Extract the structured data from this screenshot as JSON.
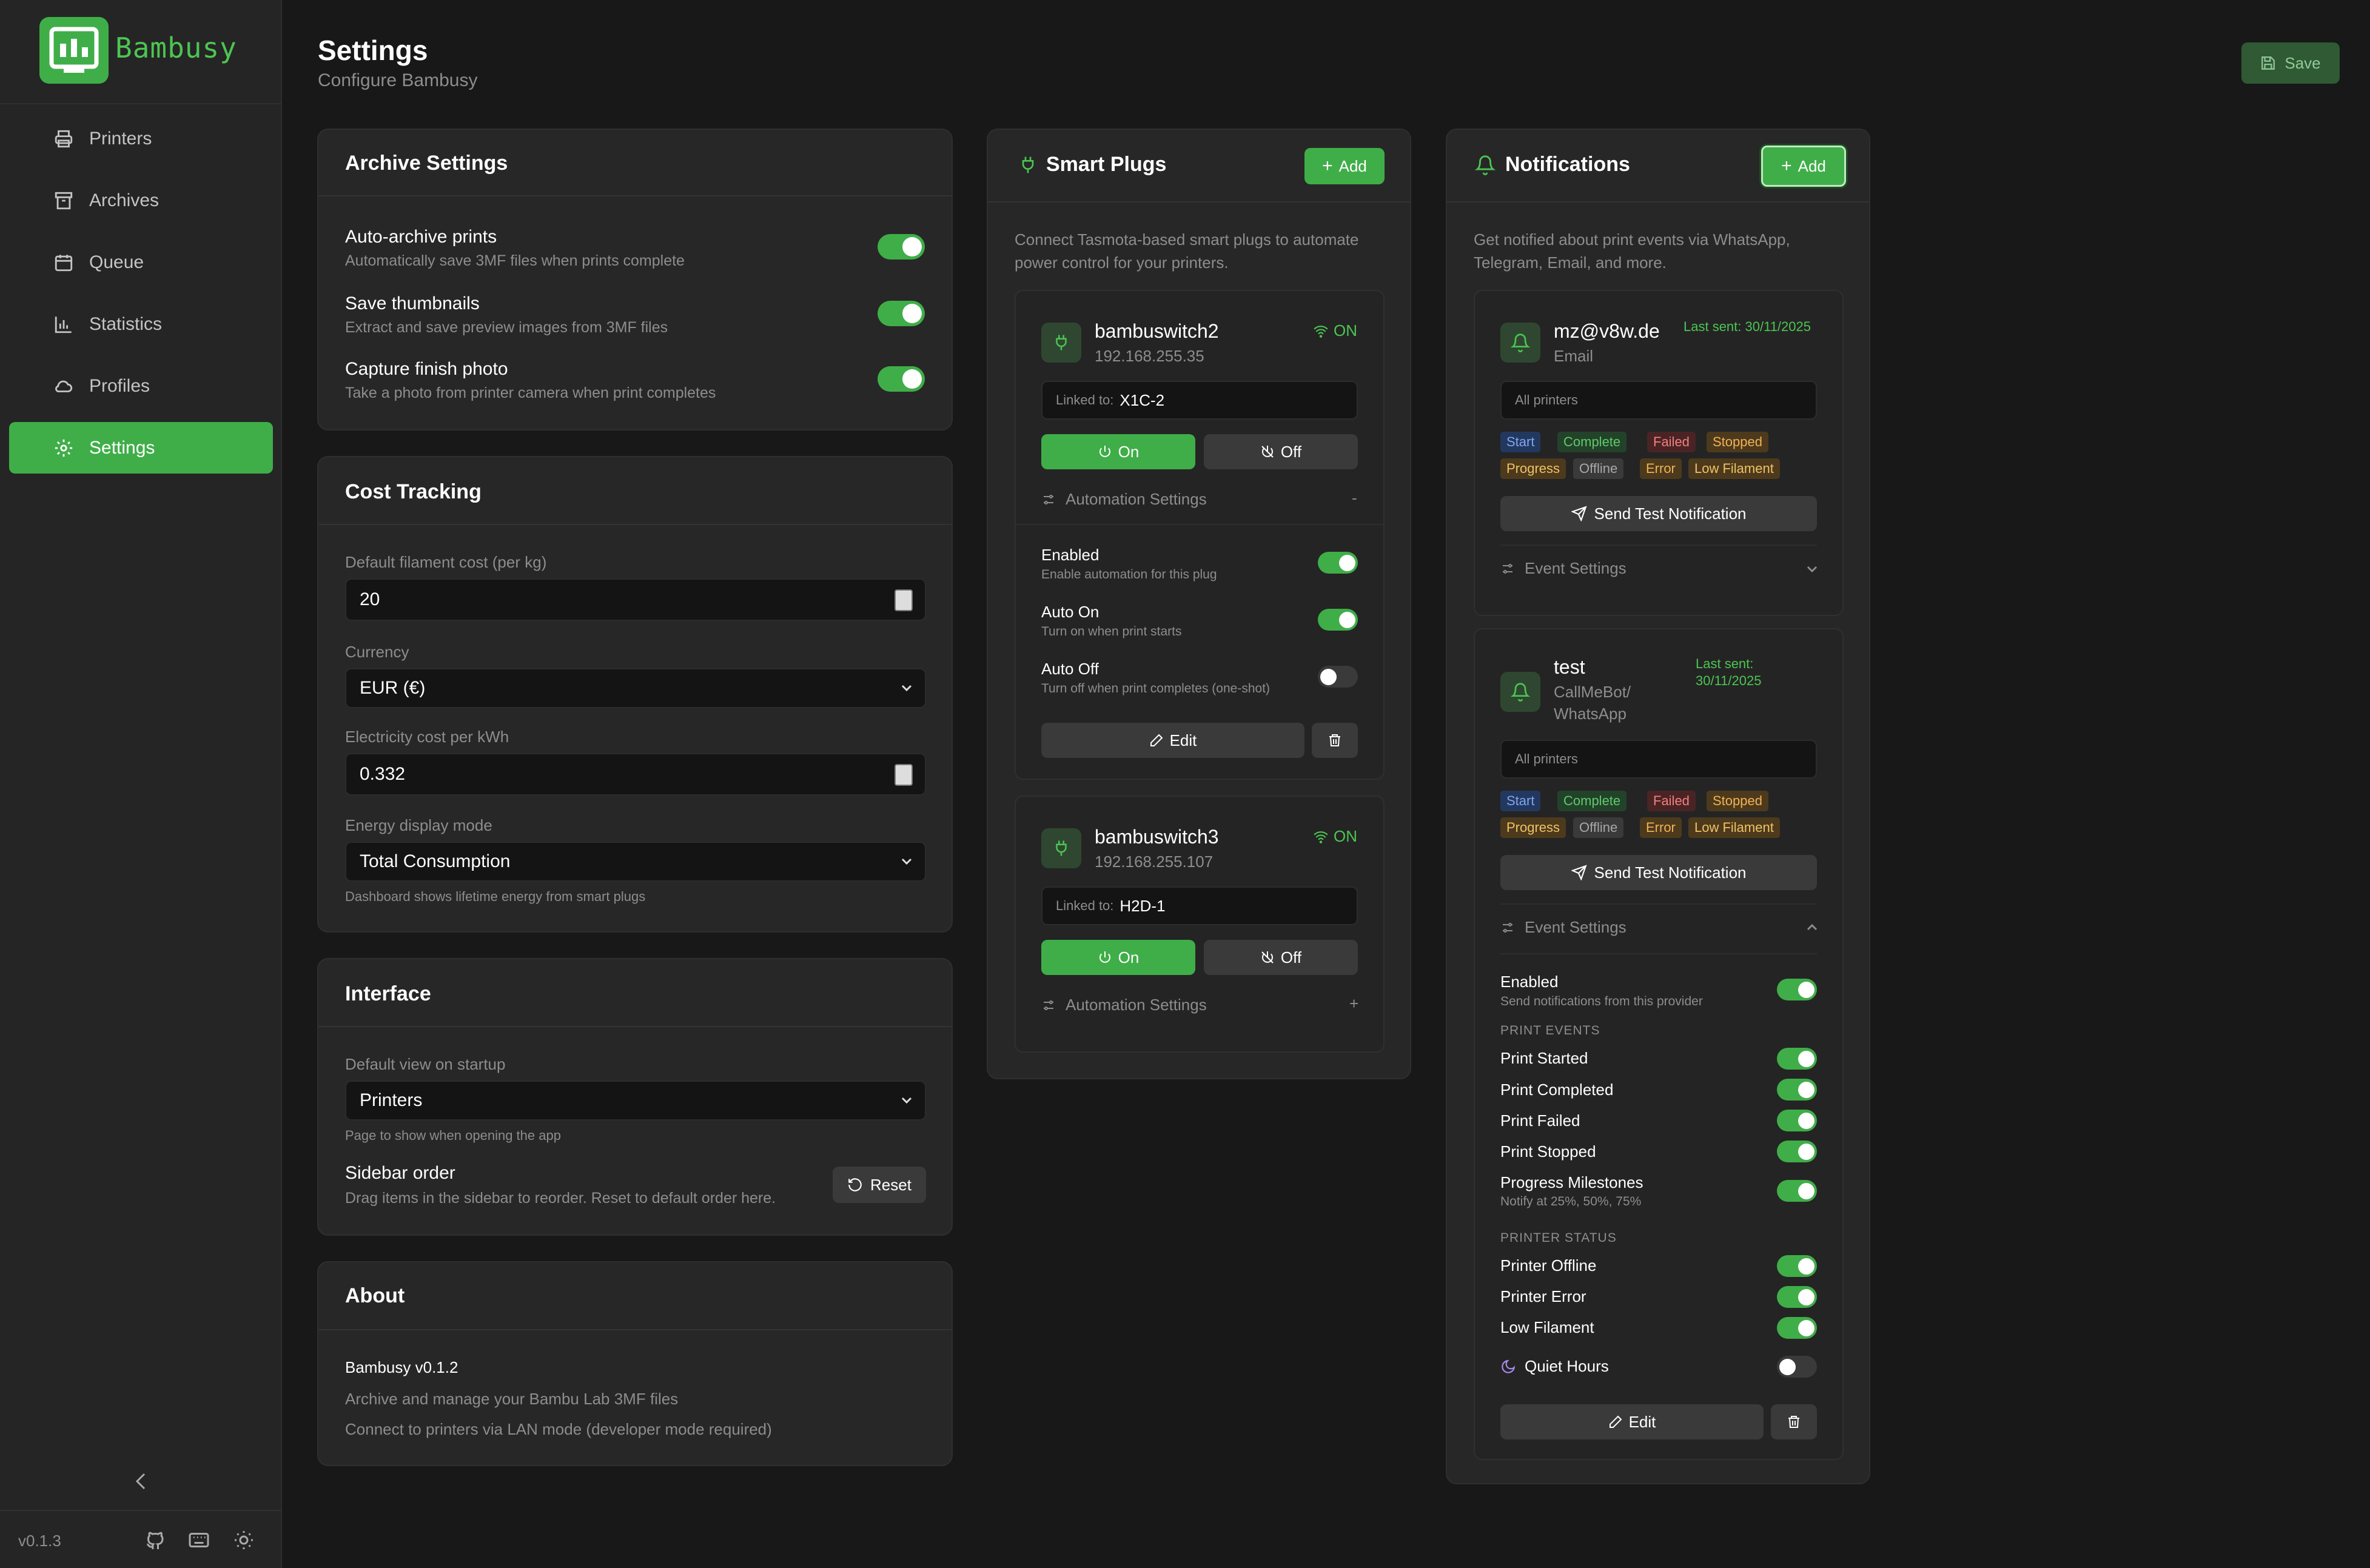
{
  "app": {
    "name": "Bambusy",
    "version": "v0.1.3"
  },
  "sidebar": {
    "items": [
      {
        "label": "Printers",
        "icon": "printer-icon"
      },
      {
        "label": "Archives",
        "icon": "archive-icon"
      },
      {
        "label": "Queue",
        "icon": "calendar-icon"
      },
      {
        "label": "Statistics",
        "icon": "chart-icon"
      },
      {
        "label": "Profiles",
        "icon": "cloud-icon"
      },
      {
        "label": "Settings",
        "icon": "gear-icon"
      }
    ],
    "active": "Settings"
  },
  "header": {
    "title": "Settings",
    "subtitle": "Configure Bambusy",
    "save_label": "Save"
  },
  "archive": {
    "title": "Archive Settings",
    "items": [
      {
        "label": "Auto-archive prints",
        "desc": "Automatically save 3MF files when prints complete",
        "enabled": true
      },
      {
        "label": "Save thumbnails",
        "desc": "Extract and save preview images from 3MF files",
        "enabled": true
      },
      {
        "label": "Capture finish photo",
        "desc": "Take a photo from printer camera when print completes",
        "enabled": true
      }
    ]
  },
  "cost": {
    "title": "Cost Tracking",
    "filament_label": "Default filament cost (per kg)",
    "filament_value": "20",
    "currency_label": "Currency",
    "currency_value": "EUR (€)",
    "electricity_label": "Electricity cost per kWh",
    "electricity_value": "0.332",
    "energy_label": "Energy display mode",
    "energy_value": "Total Consumption",
    "energy_help": "Dashboard shows lifetime energy from smart plugs"
  },
  "interface": {
    "title": "Interface",
    "view_label": "Default view on startup",
    "view_value": "Printers",
    "view_help": "Page to show when opening the app",
    "order_label": "Sidebar order",
    "order_help": "Drag items in the sidebar to reorder. Reset to default order here.",
    "reset_label": "Reset"
  },
  "about": {
    "title": "About",
    "version": "Bambusy v0.1.2",
    "line1": "Archive and manage your Bambu Lab 3MF files",
    "line2": "Connect to printers via LAN mode (developer mode required)"
  },
  "plugs": {
    "title": "Smart Plugs",
    "add_label": "Add",
    "description": "Connect Tasmota-based smart plugs to automate power control for your printers.",
    "linked_prefix": "Linked to:",
    "on_label": "On",
    "off_label": "Off",
    "automation_label": "Automation Settings",
    "edit_label": "Edit",
    "list": [
      {
        "name": "bambuswitch2",
        "ip": "192.168.255.35",
        "status": "ON",
        "linked": "X1C-2",
        "expanded_symbol": "-"
      },
      {
        "name": "bambuswitch3",
        "ip": "192.168.255.107",
        "status": "ON",
        "linked": "H2D-1",
        "expanded_symbol": "+"
      }
    ],
    "automation": [
      {
        "label": "Enabled",
        "desc": "Enable automation for this plug",
        "enabled": true
      },
      {
        "label": "Auto On",
        "desc": "Turn on when print starts",
        "enabled": true
      },
      {
        "label": "Auto Off",
        "desc": "Turn off when print completes (one-shot)",
        "enabled": false
      }
    ]
  },
  "notifications": {
    "title": "Notifications",
    "add_label": "Add",
    "description": "Get notified about print events via WhatsApp, Telegram, Email, and more.",
    "all_printers": "All printers",
    "send_test_label": "Send Test Notification",
    "event_settings_label": "Event Settings",
    "edit_label": "Edit",
    "tags": [
      "Start",
      "Complete",
      "Failed",
      "Stopped",
      "Progress",
      "Offline",
      "Error",
      "Low Filament"
    ],
    "providers": [
      {
        "name": "mz@v8w.de",
        "type": "Email",
        "last_sent": "Last sent: 30/11/2025"
      },
      {
        "name": "test",
        "type_line1": "CallMeBot/",
        "type_line2": "WhatsApp",
        "last_sent_line1": "Last sent:",
        "last_sent_line2": "30/11/2025"
      }
    ],
    "settings": {
      "enabled_label": "Enabled",
      "enabled_desc": "Send notifications from this provider",
      "print_events_header": "PRINT EVENTS",
      "print_events": [
        {
          "label": "Print Started",
          "enabled": true
        },
        {
          "label": "Print Completed",
          "enabled": true
        },
        {
          "label": "Print Failed",
          "enabled": true
        },
        {
          "label": "Print Stopped",
          "enabled": true
        },
        {
          "label": "Progress Milestones",
          "enabled": true
        }
      ],
      "progress_desc": "Notify at 25%, 50%, 75%",
      "printer_status_header": "PRINTER STATUS",
      "printer_status": [
        {
          "label": "Printer Offline",
          "enabled": true
        },
        {
          "label": "Printer Error",
          "enabled": true
        },
        {
          "label": "Low Filament",
          "enabled": true
        }
      ],
      "quiet_hours_label": "Quiet Hours",
      "quiet_hours_enabled": false
    }
  },
  "colors": {
    "accent": "#3fae48",
    "background": "#181818",
    "card": "#272727"
  }
}
